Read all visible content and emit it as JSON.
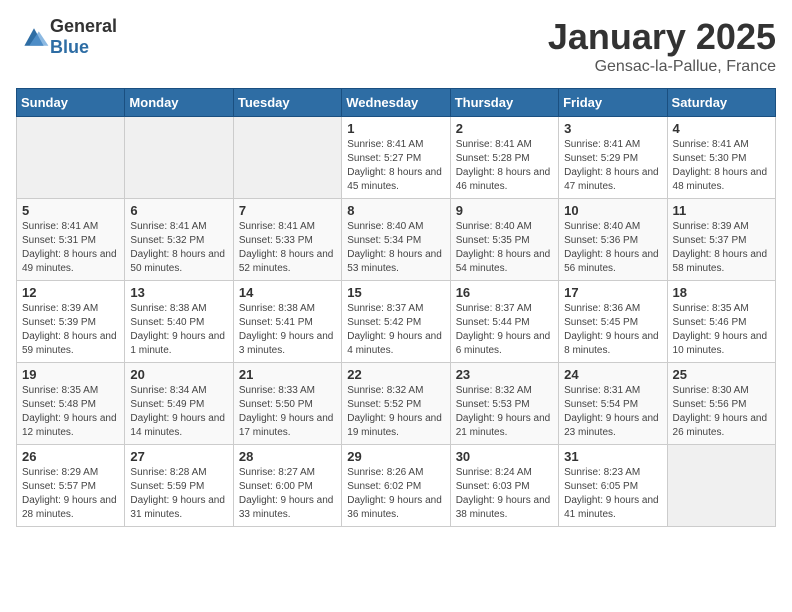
{
  "header": {
    "logo_general": "General",
    "logo_blue": "Blue",
    "title": "January 2025",
    "subtitle": "Gensac-la-Pallue, France"
  },
  "weekdays": [
    "Sunday",
    "Monday",
    "Tuesday",
    "Wednesday",
    "Thursday",
    "Friday",
    "Saturday"
  ],
  "weeks": [
    [
      {
        "day": "",
        "empty": true
      },
      {
        "day": "",
        "empty": true
      },
      {
        "day": "",
        "empty": true
      },
      {
        "day": "1",
        "sunrise": "8:41 AM",
        "sunset": "5:27 PM",
        "daylight": "8 hours and 45 minutes."
      },
      {
        "day": "2",
        "sunrise": "8:41 AM",
        "sunset": "5:28 PM",
        "daylight": "8 hours and 46 minutes."
      },
      {
        "day": "3",
        "sunrise": "8:41 AM",
        "sunset": "5:29 PM",
        "daylight": "8 hours and 47 minutes."
      },
      {
        "day": "4",
        "sunrise": "8:41 AM",
        "sunset": "5:30 PM",
        "daylight": "8 hours and 48 minutes."
      }
    ],
    [
      {
        "day": "5",
        "sunrise": "8:41 AM",
        "sunset": "5:31 PM",
        "daylight": "8 hours and 49 minutes."
      },
      {
        "day": "6",
        "sunrise": "8:41 AM",
        "sunset": "5:32 PM",
        "daylight": "8 hours and 50 minutes."
      },
      {
        "day": "7",
        "sunrise": "8:41 AM",
        "sunset": "5:33 PM",
        "daylight": "8 hours and 52 minutes."
      },
      {
        "day": "8",
        "sunrise": "8:40 AM",
        "sunset": "5:34 PM",
        "daylight": "8 hours and 53 minutes."
      },
      {
        "day": "9",
        "sunrise": "8:40 AM",
        "sunset": "5:35 PM",
        "daylight": "8 hours and 54 minutes."
      },
      {
        "day": "10",
        "sunrise": "8:40 AM",
        "sunset": "5:36 PM",
        "daylight": "8 hours and 56 minutes."
      },
      {
        "day": "11",
        "sunrise": "8:39 AM",
        "sunset": "5:37 PM",
        "daylight": "8 hours and 58 minutes."
      }
    ],
    [
      {
        "day": "12",
        "sunrise": "8:39 AM",
        "sunset": "5:39 PM",
        "daylight": "8 hours and 59 minutes."
      },
      {
        "day": "13",
        "sunrise": "8:38 AM",
        "sunset": "5:40 PM",
        "daylight": "9 hours and 1 minute."
      },
      {
        "day": "14",
        "sunrise": "8:38 AM",
        "sunset": "5:41 PM",
        "daylight": "9 hours and 3 minutes."
      },
      {
        "day": "15",
        "sunrise": "8:37 AM",
        "sunset": "5:42 PM",
        "daylight": "9 hours and 4 minutes."
      },
      {
        "day": "16",
        "sunrise": "8:37 AM",
        "sunset": "5:44 PM",
        "daylight": "9 hours and 6 minutes."
      },
      {
        "day": "17",
        "sunrise": "8:36 AM",
        "sunset": "5:45 PM",
        "daylight": "9 hours and 8 minutes."
      },
      {
        "day": "18",
        "sunrise": "8:35 AM",
        "sunset": "5:46 PM",
        "daylight": "9 hours and 10 minutes."
      }
    ],
    [
      {
        "day": "19",
        "sunrise": "8:35 AM",
        "sunset": "5:48 PM",
        "daylight": "9 hours and 12 minutes."
      },
      {
        "day": "20",
        "sunrise": "8:34 AM",
        "sunset": "5:49 PM",
        "daylight": "9 hours and 14 minutes."
      },
      {
        "day": "21",
        "sunrise": "8:33 AM",
        "sunset": "5:50 PM",
        "daylight": "9 hours and 17 minutes."
      },
      {
        "day": "22",
        "sunrise": "8:32 AM",
        "sunset": "5:52 PM",
        "daylight": "9 hours and 19 minutes."
      },
      {
        "day": "23",
        "sunrise": "8:32 AM",
        "sunset": "5:53 PM",
        "daylight": "9 hours and 21 minutes."
      },
      {
        "day": "24",
        "sunrise": "8:31 AM",
        "sunset": "5:54 PM",
        "daylight": "9 hours and 23 minutes."
      },
      {
        "day": "25",
        "sunrise": "8:30 AM",
        "sunset": "5:56 PM",
        "daylight": "9 hours and 26 minutes."
      }
    ],
    [
      {
        "day": "26",
        "sunrise": "8:29 AM",
        "sunset": "5:57 PM",
        "daylight": "9 hours and 28 minutes."
      },
      {
        "day": "27",
        "sunrise": "8:28 AM",
        "sunset": "5:59 PM",
        "daylight": "9 hours and 31 minutes."
      },
      {
        "day": "28",
        "sunrise": "8:27 AM",
        "sunset": "6:00 PM",
        "daylight": "9 hours and 33 minutes."
      },
      {
        "day": "29",
        "sunrise": "8:26 AM",
        "sunset": "6:02 PM",
        "daylight": "9 hours and 36 minutes."
      },
      {
        "day": "30",
        "sunrise": "8:24 AM",
        "sunset": "6:03 PM",
        "daylight": "9 hours and 38 minutes."
      },
      {
        "day": "31",
        "sunrise": "8:23 AM",
        "sunset": "6:05 PM",
        "daylight": "9 hours and 41 minutes."
      },
      {
        "day": "",
        "empty": true
      }
    ]
  ]
}
